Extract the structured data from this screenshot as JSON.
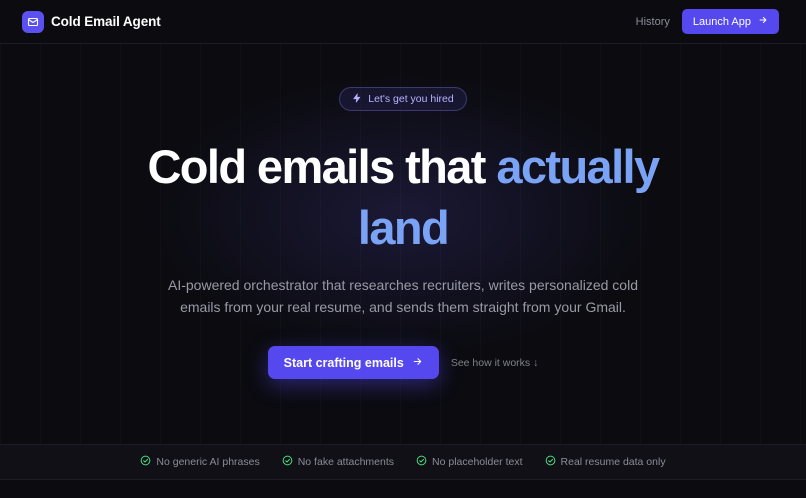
{
  "app": {
    "name": "Cold Email Agent"
  },
  "nav": {
    "history": "History",
    "launch": "Launch App"
  },
  "hero": {
    "pill": "Let's get you hired",
    "headline_part1": "Cold emails that ",
    "headline_accent_1": "actually",
    "headline_accent_2": "land",
    "subtitle": "AI-powered orchestrator that researches recruiters, writes personalized cold emails from your real resume, and sends them straight from your Gmail.",
    "primary_cta": "Start crafting emails",
    "secondary_cta": "See how it works ↓"
  },
  "features": [
    {
      "label": "No generic AI phrases"
    },
    {
      "label": "No fake attachments"
    },
    {
      "label": "No placeholder text"
    },
    {
      "label": "Real resume data only"
    }
  ],
  "colors": {
    "background": "#0b0b10",
    "accent": "#5548ee",
    "headline_accent": "#7aa2f5",
    "check": "#4ade80"
  },
  "icons": {
    "brand": "mail-icon",
    "launch": "arrow-right-icon",
    "pill": "bolt-icon",
    "feature": "check-circle-icon"
  }
}
